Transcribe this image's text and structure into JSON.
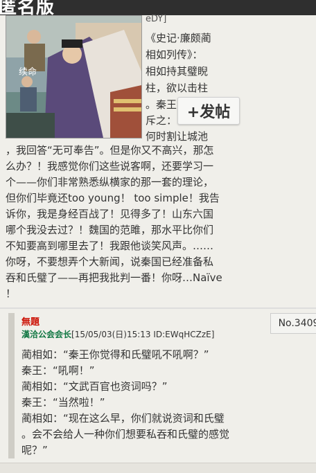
{
  "header": {
    "title": "匿名版"
  },
  "post1": {
    "id_fragment": "eDY]",
    "float_lines": [
      "《史记·廉颇蔺",
      "相如列传》：",
      "相如持其璧睨",
      "柱，欲以击柱",
      "。秦王",
      "斥之：",
      "何时割让城池"
    ],
    "body_lines": [
      "，我回答“无可奉告”。但是你又不高兴，那怎",
      "么办？！我感觉你们这些说客啊，还要学习一",
      "个——你们非常熟悉纵横家的那一套的理论，",
      "但你们毕竟还too young！ too simple！我告",
      "诉你，我是身经百战了！见得多了！山东六国",
      "哪个我没去过？！魏国的范雎，那水平比你们",
      "不知要高到哪里去了！我跟他谈笑风声。……",
      "你呀，不要想弄个大新闻，说秦国已经准备私",
      "吞和氏璧了——再把我批判一番！你呀…Naïve",
      "！"
    ],
    "image_caption": "续命"
  },
  "post_button": {
    "label": "+发帖"
  },
  "post2": {
    "title": "無題",
    "author": "漢洽公会会长",
    "meta": "[15/05/03(日)15:13 ID:EWqHCZzE]",
    "number": "No.3409",
    "lines": [
      "蔺相如：“秦王你觉得和氏璧吼不吼啊？”",
      "秦王：“吼啊！”",
      "蔺相如：“文武百官也资词吗？”",
      "秦王：“当然啦！”",
      "蔺相如：“现在这么早，你们就说资词和氏璧",
      "。会不会给人一种你们想要私吞和氏璧的感觉",
      "呢？”"
    ]
  },
  "colors": {
    "title_red": "#cc1105",
    "author_green": "#117743",
    "topbar": "#2f2f2f"
  }
}
